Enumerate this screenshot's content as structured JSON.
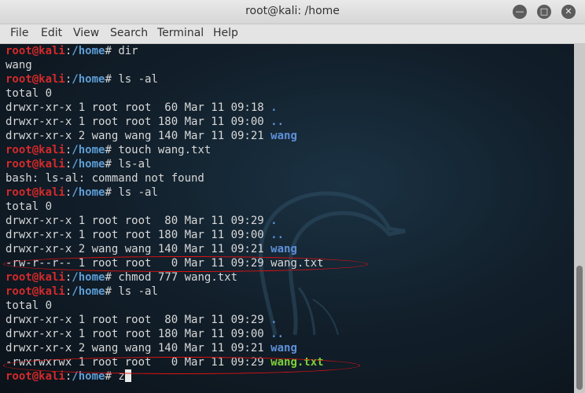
{
  "window": {
    "title": "root@kali: /home"
  },
  "window_controls": {
    "minimize": "—",
    "maximize": "□",
    "close": "✕"
  },
  "menu": [
    "File",
    "Edit",
    "View",
    "Search",
    "Terminal",
    "Help"
  ],
  "prompt": {
    "user": "root@kali",
    "sep": ":",
    "path": "/home",
    "symbol": "#"
  },
  "lines": [
    {
      "type": "prompt",
      "cmd": "dir"
    },
    {
      "type": "out",
      "text": "wang"
    },
    {
      "type": "prompt",
      "cmd": "ls -al"
    },
    {
      "type": "out",
      "text": "total 0"
    },
    {
      "type": "ls",
      "meta": "drwxr-xr-x 1 root root  60 Mar 11 09:18 ",
      "name": ".",
      "kind": "dir"
    },
    {
      "type": "ls",
      "meta": "drwxr-xr-x 1 root root 180 Mar 11 09:00 ",
      "name": "..",
      "kind": "dir"
    },
    {
      "type": "ls",
      "meta": "drwxr-xr-x 2 wang wang 140 Mar 11 09:21 ",
      "name": "wang",
      "kind": "dir"
    },
    {
      "type": "prompt",
      "cmd": "touch wang.txt"
    },
    {
      "type": "prompt",
      "cmd": "ls-al"
    },
    {
      "type": "out",
      "text": "bash: ls-al: command not found"
    },
    {
      "type": "prompt",
      "cmd": "ls -al"
    },
    {
      "type": "out",
      "text": "total 0"
    },
    {
      "type": "ls",
      "meta": "drwxr-xr-x 1 root root  80 Mar 11 09:29 ",
      "name": ".",
      "kind": "dir"
    },
    {
      "type": "ls",
      "meta": "drwxr-xr-x 1 root root 180 Mar 11 09:00 ",
      "name": "..",
      "kind": "dir"
    },
    {
      "type": "ls",
      "meta": "drwxr-xr-x 2 wang wang 140 Mar 11 09:21 ",
      "name": "wang",
      "kind": "dir"
    },
    {
      "type": "ls",
      "meta": "-rw-r--r-- 1 root root   0 Mar 11 09:29 ",
      "name": "wang.txt",
      "kind": "file"
    },
    {
      "type": "prompt",
      "cmd": "chmod 777 wang.txt"
    },
    {
      "type": "prompt",
      "cmd": "ls -al"
    },
    {
      "type": "out",
      "text": "total 0"
    },
    {
      "type": "ls",
      "meta": "drwxr-xr-x 1 root root  80 Mar 11 09:29 ",
      "name": ".",
      "kind": "dir"
    },
    {
      "type": "ls",
      "meta": "drwxr-xr-x 1 root root 180 Mar 11 09:00 ",
      "name": "..",
      "kind": "dir"
    },
    {
      "type": "ls",
      "meta": "drwxr-xr-x 2 wang wang 140 Mar 11 09:21 ",
      "name": "wang",
      "kind": "dir"
    },
    {
      "type": "ls",
      "meta": "-rwxrwxrwx 1 root root   0 Mar 11 09:29 ",
      "name": "wang.txt",
      "kind": "exe"
    },
    {
      "type": "prompt",
      "cmd": "z",
      "cursor": true
    }
  ],
  "colors": {
    "prompt_user": "#d42a2a",
    "prompt_path": "#5e9ed6",
    "dir": "#5e8fd8",
    "executable": "#7fd13a",
    "annotation": "#dd1111"
  }
}
